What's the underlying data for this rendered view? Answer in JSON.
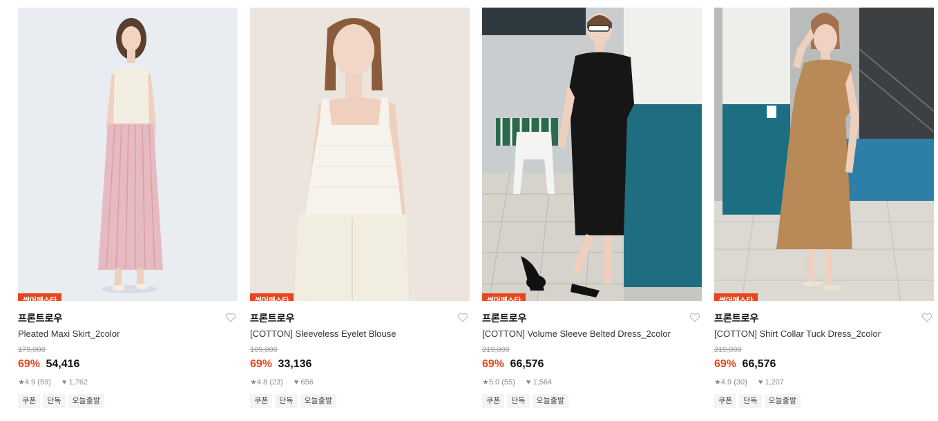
{
  "theme": {
    "badge_color": "#e8461e",
    "discount_color": "#e8461e"
  },
  "products": [
    {
      "badge": "썸머페스타",
      "brand": "프론트로우",
      "name": "Pleated Maxi Skirt_2color",
      "original_price": "179,000",
      "discount": "69%",
      "price": "54,416",
      "rating": "4.9",
      "reviews": "(59)",
      "likes": "1,762",
      "tags": [
        "쿠폰",
        "단독",
        "오늘출발"
      ],
      "image_icon": "model-pink-pleated-skirt"
    },
    {
      "badge": "썸머페스타",
      "brand": "프론트로우",
      "name": "[COTTON] Sleeveless Eyelet Blouse",
      "original_price": "109,000",
      "discount": "69%",
      "price": "33,136",
      "rating": "4.8",
      "reviews": "(23)",
      "likes": "656",
      "tags": [
        "쿠폰",
        "단독",
        "오늘출발"
      ],
      "image_icon": "model-white-blouse"
    },
    {
      "badge": "썸머페스타",
      "brand": "프론트로우",
      "name": "[COTTON] Volume Sleeve Belted Dress_2color",
      "original_price": "219,000",
      "discount": "69%",
      "price": "66,576",
      "rating": "5.0",
      "reviews": "(55)",
      "likes": "1,564",
      "tags": [
        "쿠폰",
        "단독",
        "오늘출발"
      ],
      "image_icon": "model-black-dress-poolside"
    },
    {
      "badge": "썸머페스타",
      "brand": "프론트로우",
      "name": "[COTTON] Shirt Collar Tuck Dress_2color",
      "original_price": "219,000",
      "discount": "69%",
      "price": "66,576",
      "rating": "4.9",
      "reviews": "(30)",
      "likes": "1,207",
      "tags": [
        "쿠폰",
        "단독",
        "오늘출발"
      ],
      "image_icon": "model-camel-shirt-dress"
    }
  ]
}
